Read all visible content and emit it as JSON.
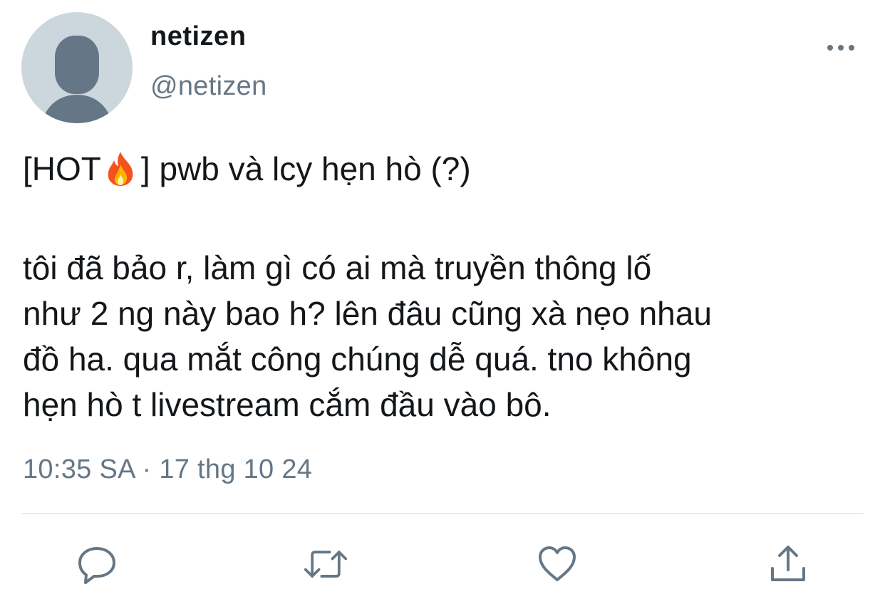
{
  "user": {
    "display_name": "netizen",
    "handle": "@netizen",
    "avatar_icon": "default-avatar-icon"
  },
  "more_icon": "more-horizontal-icon",
  "tweet": {
    "headline_prefix": "[HOT",
    "headline_emoji": "fire-emoji",
    "headline_suffix": "] pwb và lcy hẹn hò (?)",
    "body_lines": [
      "tôi đã bảo r, làm gì có ai mà truyền thông lố",
      "như 2 ng này bao h? lên đâu cũng xà nẹo nhau",
      "đồ ha. qua mắt công chúng dễ quá. tno không",
      "hẹn hò t livestream cắm đầu vào bô."
    ],
    "timestamp": "10:35 SA · 17 thg 10 24"
  },
  "actions": {
    "reply_icon": "reply-icon",
    "retweet_icon": "retweet-icon",
    "like_icon": "heart-icon",
    "share_icon": "share-icon"
  },
  "colors": {
    "primary_text": "#14171a",
    "secondary_text": "#657786",
    "avatar_bg": "#ccd6dd",
    "avatar_fg": "#657786",
    "divider": "#e6ecf0"
  }
}
